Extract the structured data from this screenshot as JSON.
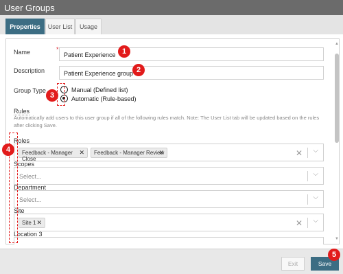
{
  "window": {
    "title": "User Groups"
  },
  "tabs": [
    {
      "label": "Properties",
      "active": true
    },
    {
      "label": "User List",
      "active": false
    },
    {
      "label": "Usage",
      "active": false
    }
  ],
  "form": {
    "name": {
      "label": "Name",
      "required_mark": "*",
      "value": "Patient Experience"
    },
    "description": {
      "label": "Description",
      "value": "Patient Experience group"
    },
    "group_type": {
      "label": "Group Type",
      "options": [
        {
          "label": "Manual (Defined list)",
          "checked": false
        },
        {
          "label": "Automatic (Rule-based)",
          "checked": true
        }
      ]
    }
  },
  "rules": {
    "heading": "Rules",
    "description": "Automatically add users to this user group if all of the following rules match. Note: The User List tab will be updated based on the rules after clicking Save.",
    "fields": {
      "roles": {
        "label": "Roles",
        "chips": [
          "Feedback - Manager Close",
          "Feedback - Manager Review"
        ]
      },
      "scopes": {
        "label": "Scopes",
        "placeholder": "Select..."
      },
      "department": {
        "label": "Department",
        "placeholder": "Select..."
      },
      "site": {
        "label": "Site",
        "chips": [
          "Site 1"
        ]
      },
      "location3": {
        "label": "Location 3"
      }
    }
  },
  "footer": {
    "exit_label": "Exit",
    "save_label": "Save"
  },
  "annotations": [
    "1",
    "2",
    "3",
    "4",
    "5"
  ],
  "colors": {
    "accent": "#3c6d83",
    "callout": "#e21b1b",
    "titlebar": "#6b6b6b"
  }
}
